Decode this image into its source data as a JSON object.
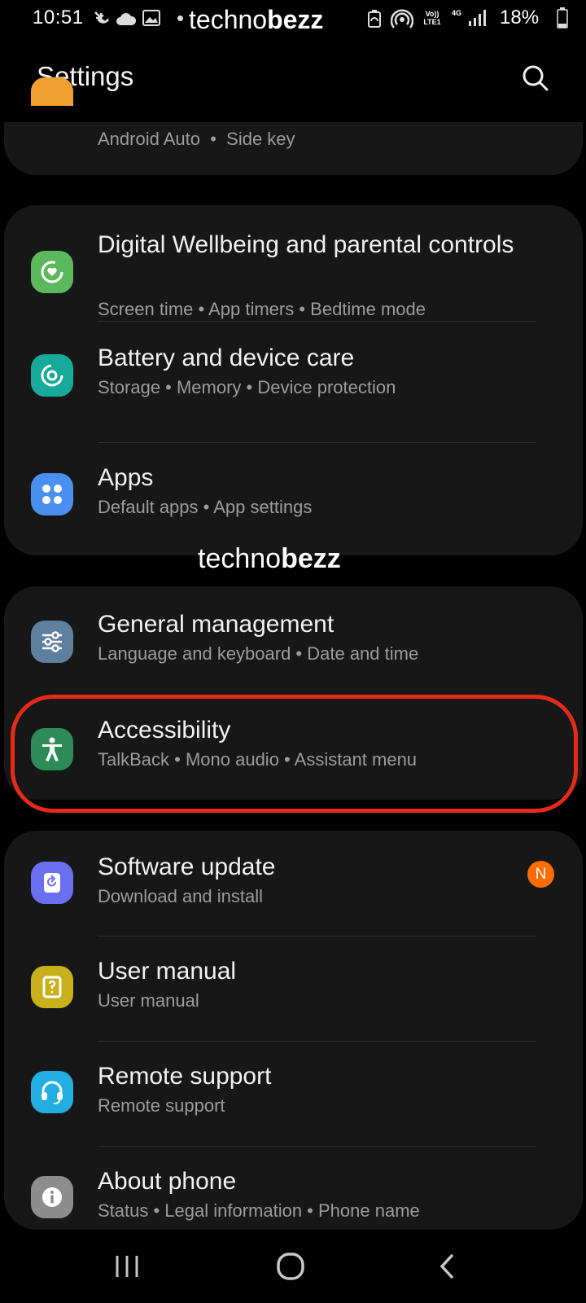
{
  "status_bar": {
    "time": "10:51",
    "watermark_light": "techno",
    "watermark_bold": "bezz",
    "volte": "Vo)) LTE1",
    "network": "4G",
    "battery": "18%"
  },
  "header": {
    "title": "Settings",
    "search_icon": "search-icon"
  },
  "partial_item": {
    "subtitle_parts": [
      "Android Auto",
      "Side key"
    ]
  },
  "watermark": {
    "light": "techno",
    "bold": "bezz"
  },
  "groups": [
    {
      "items": [
        {
          "title": "Digital Wellbeing and parental controls",
          "subtitle": "Screen time  •  App timers  •  Bedtime mode",
          "icon": "digital-wellbeing-icon",
          "icon_color": "#5cb85c"
        },
        {
          "title": "Battery and device care",
          "subtitle": "Storage  •  Memory  •  Device protection",
          "icon": "device-care-icon",
          "icon_color": "#17a99a"
        },
        {
          "title": "Apps",
          "subtitle": "Default apps  •  App settings",
          "icon": "apps-icon",
          "icon_color": "#4a90f0"
        }
      ]
    },
    {
      "items": [
        {
          "title": "General management",
          "subtitle": "Language and keyboard  •  Date and time",
          "icon": "sliders-icon",
          "icon_color": "#5e7f9e"
        },
        {
          "title": "Accessibility",
          "subtitle": "TalkBack  •  Mono audio  •  Assistant menu",
          "icon": "accessibility-icon",
          "icon_color": "#2e8b57"
        }
      ]
    },
    {
      "items": [
        {
          "title": "Software update",
          "subtitle": "Download and install",
          "icon": "software-update-icon",
          "icon_color": "#6a6ff0",
          "badge": "N",
          "badge_color": "#ff6d00"
        },
        {
          "title": "User manual",
          "subtitle": "User manual",
          "icon": "user-manual-icon",
          "icon_color": "#c9b01a"
        },
        {
          "title": "Remote support",
          "subtitle": "Remote support",
          "icon": "headset-icon",
          "icon_color": "#22aee0"
        },
        {
          "title": "About phone",
          "subtitle": "Status  •  Legal information  •  Phone name",
          "icon": "info-icon",
          "icon_color": "#8d8d8d"
        }
      ]
    }
  ],
  "highlight_color": "#e52a19",
  "nav_bar": {
    "recents": "recents-icon",
    "home": "home-icon",
    "back": "back-icon"
  }
}
